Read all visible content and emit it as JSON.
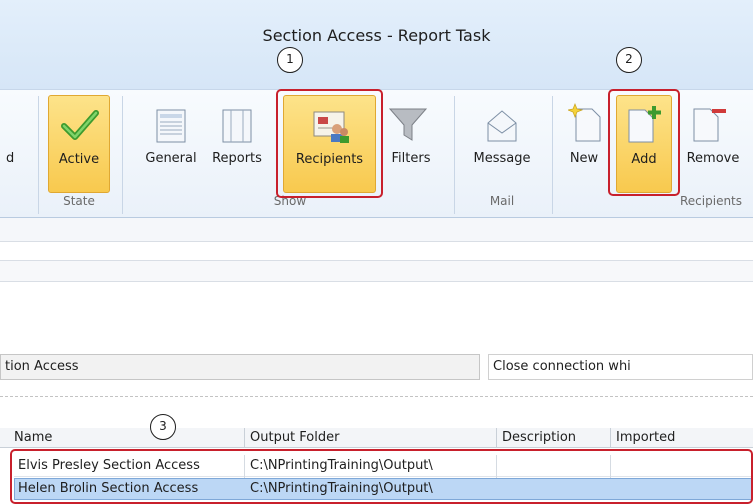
{
  "window": {
    "title": "Section Access - Report Task"
  },
  "ribbon": {
    "partial_left_label": "d",
    "groups": {
      "state": {
        "label": "State",
        "buttons": [
          {
            "label": "Active"
          }
        ]
      },
      "show": {
        "label": "Show",
        "buttons": [
          {
            "label": "General"
          },
          {
            "label": "Reports"
          },
          {
            "label": "Recipients"
          },
          {
            "label": "Filters"
          }
        ]
      },
      "mail": {
        "label": "Mail",
        "buttons": [
          {
            "label": "Message"
          }
        ]
      },
      "recipients": {
        "label": "Recipients",
        "buttons": [
          {
            "label": "New"
          },
          {
            "label": "Add"
          },
          {
            "label": "Remove"
          }
        ]
      }
    }
  },
  "callouts": [
    "1",
    "2",
    "3"
  ],
  "connection": {
    "name_value": "tion Access",
    "close_label": "Close connection whi"
  },
  "grid": {
    "columns": [
      "Name",
      "Output Folder",
      "Description",
      "Imported"
    ],
    "rows": [
      {
        "name": "Elvis Presley Section Access",
        "output_folder": "C:\\NPrintingTraining\\Output\\",
        "description": "",
        "imported": ""
      },
      {
        "name": "Helen Brolin Section Access",
        "output_folder": "C:\\NPrintingTraining\\Output\\",
        "description": "",
        "imported": ""
      }
    ]
  },
  "colors": {
    "accent_yellow": "#f8c94e",
    "highlight_red": "#c8202c",
    "selected_row": "#bcd7f5"
  }
}
